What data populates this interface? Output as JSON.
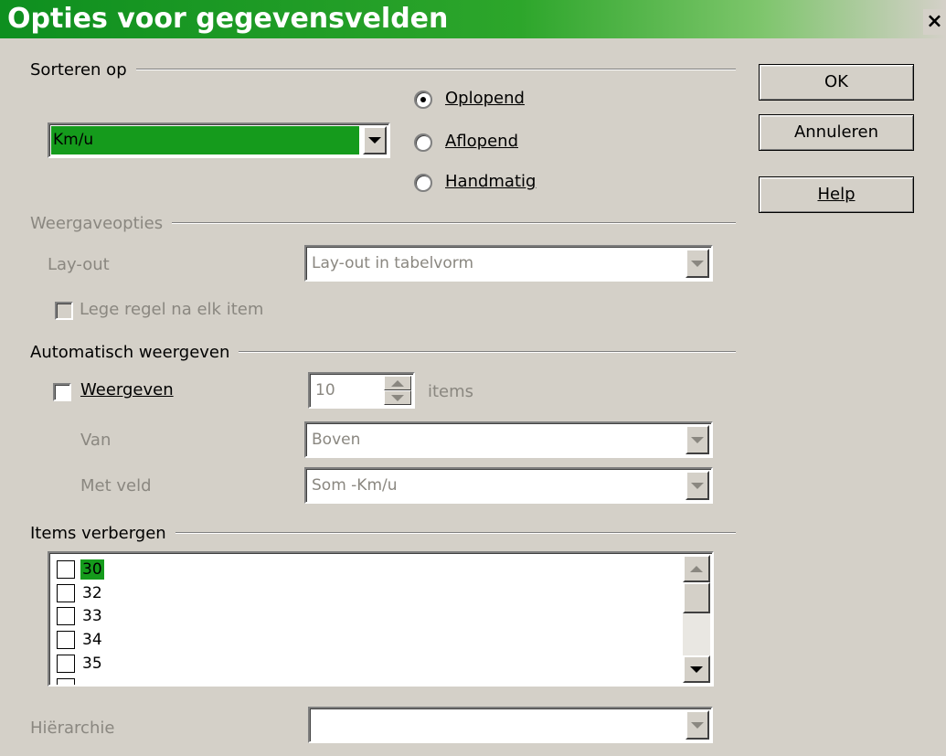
{
  "window": {
    "title": "Opties voor gegevensvelden",
    "close_label": "×"
  },
  "buttons": {
    "ok": "OK",
    "cancel": "Annuleren",
    "help": "Help"
  },
  "sort": {
    "header": "Sorteren op",
    "field_value": "Km/u",
    "options": [
      "Oplopend",
      "Aflopend",
      "Handmatig"
    ],
    "selected": "Oplopend"
  },
  "display": {
    "header": "Weergaveopties",
    "layout_label": "Lay-out",
    "layout_value": "Lay-out in tabelvorm",
    "empty_line_label": "Lege regel na elk item"
  },
  "auto_show": {
    "header": "Automatisch weergeven",
    "show_label": "Weergeven",
    "count_value": "10",
    "items_label": "items",
    "from_label": "Van",
    "from_value": "Boven",
    "field_label": "Met veld",
    "field_value": "Som -Km/u"
  },
  "hide_items": {
    "header": "Items verbergen",
    "items": [
      "30",
      "32",
      "33",
      "34",
      "35"
    ]
  },
  "hierarchy": {
    "label": "Hiërarchie",
    "value": ""
  },
  "colors": {
    "title_green": "#0e8f1f",
    "selection_green": "#159b1c",
    "dialog_bg": "#d4d0c8"
  }
}
